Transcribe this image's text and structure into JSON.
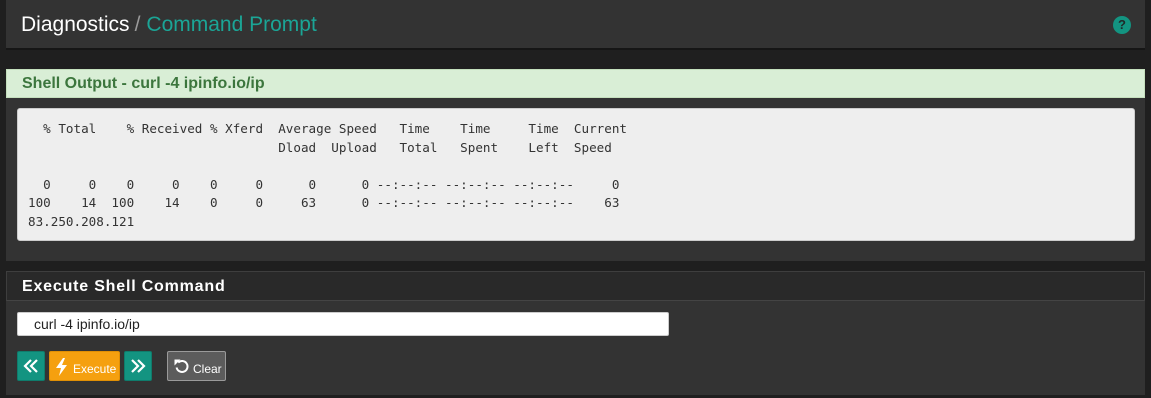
{
  "header": {
    "breadcrumb_root": "Diagnostics",
    "breadcrumb_separator": "/",
    "breadcrumb_current": "Command Prompt",
    "help_icon": "question-circle-icon",
    "help_label": "?"
  },
  "output_panel": {
    "title": "Shell Output - curl -4 ipinfo.io/ip",
    "lines": [
      "  % Total    % Received % Xferd  Average Speed   Time    Time     Time  Current",
      "                                 Dload  Upload   Total   Spent    Left  Speed",
      "",
      "  0     0    0     0    0     0      0      0 --:--:-- --:--:-- --:--:--     0",
      "100    14  100    14    0     0     63      0 --:--:-- --:--:-- --:--:--    63",
      "83.250.208.121"
    ]
  },
  "exec_panel": {
    "title": "Execute Shell Command",
    "command_value": "curl -4 ipinfo.io/ip",
    "buttons": {
      "prev_icon": "angle-double-left-icon",
      "execute_icon": "bolt-icon",
      "execute_label": "Execute",
      "next_icon": "angle-double-right-icon",
      "clear_icon": "undo-icon",
      "clear_label": "Clear"
    }
  },
  "colors": {
    "accent_teal": "#139481",
    "breadcrumb_teal": "#1ba596",
    "execute_orange": "#f5a00f",
    "success_bg": "#d9eed6",
    "success_text": "#3c763d"
  }
}
